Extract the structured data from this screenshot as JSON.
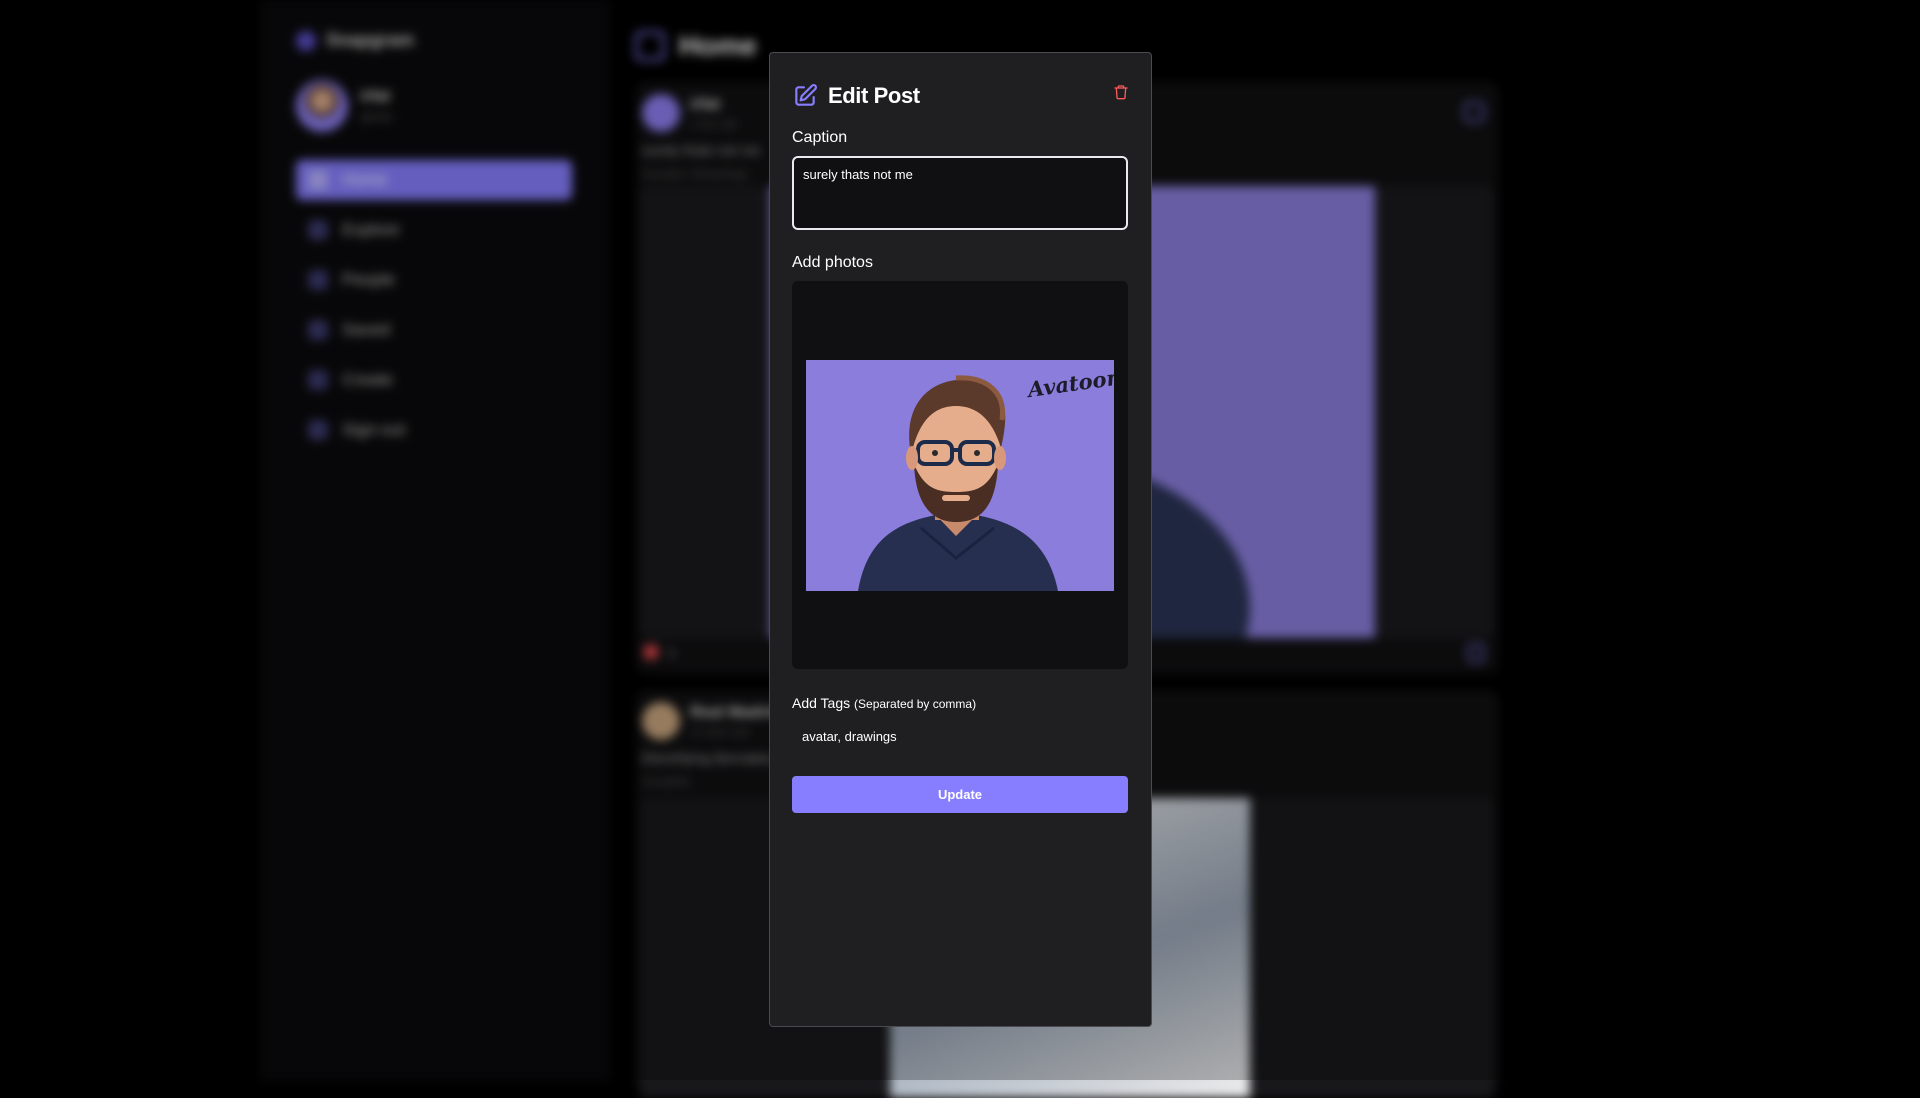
{
  "app": {
    "brand": "Snapgram",
    "user": {
      "name": "irfat",
      "handle": "@irfat"
    },
    "nav": [
      {
        "label": "Home",
        "active": true
      },
      {
        "label": "Explore"
      },
      {
        "label": "People"
      },
      {
        "label": "Saved"
      },
      {
        "label": "Create"
      },
      {
        "label": "Sign-out"
      }
    ],
    "page_title": "Home",
    "posts": [
      {
        "author": "irfat",
        "time": "1 day ago",
        "caption": "surely thats not me",
        "tags": "#avatar #drawings",
        "likes": "1"
      },
      {
        "author": "Real Madrid",
        "time": "12 days ago",
        "caption": "Electrifying Bernabéu",
        "tags": "#madrid"
      }
    ]
  },
  "modal": {
    "title": "Edit Post",
    "caption_label": "Caption",
    "caption_value": "surely thats not me",
    "photos_label": "Add photos",
    "photo_watermark": "Avatoon",
    "tags_label": "Add Tags",
    "tags_hint": "(Separated by comma)",
    "tags_value": "avatar, drawings",
    "update_label": "Update"
  },
  "colors": {
    "accent": "#877eff",
    "modal_bg": "#1f1f22",
    "input_bg": "#101012",
    "danger": "#ff5a5a",
    "photo_bg": "#8a7ddb"
  }
}
